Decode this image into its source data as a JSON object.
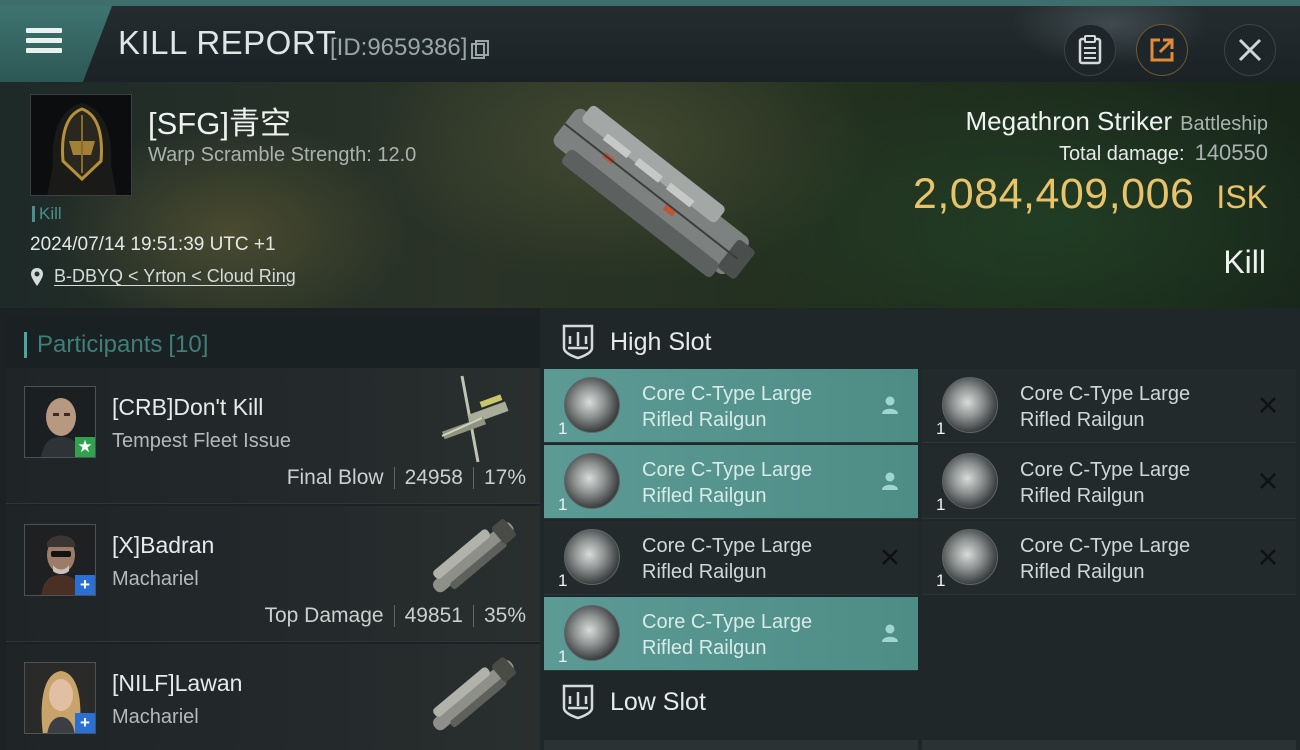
{
  "header": {
    "title": "KILL REPORT",
    "report_id": "[ID:9659386]"
  },
  "victim": {
    "name": "[SFG]青空",
    "warp_scramble": "Warp Scramble Strength: 12.0",
    "tag": "Kill",
    "timestamp": "2024/07/14 19:51:39 UTC +1",
    "location": "B-DBYQ < Yrton < Cloud Ring",
    "ship_name": "Megathron Striker",
    "ship_class": "Battleship",
    "total_damage_label": "Total damage:",
    "total_damage": "140550",
    "isk_value": "2,084,409,006",
    "isk_unit": "ISK",
    "kill_label": "Kill"
  },
  "participants": {
    "label": "Participants",
    "count": "[10]",
    "rows": [
      {
        "name": "[CRB]Don't Kill",
        "ship": "Tempest Fleet Issue",
        "stat_label": "Final Blow",
        "damage": "24958",
        "percent": "17%",
        "badge": "star"
      },
      {
        "name": "[X]Badran",
        "ship": "Machariel",
        "stat_label": "Top Damage",
        "damage": "49851",
        "percent": "35%",
        "badge": "plus"
      },
      {
        "name": "[NILF]Lawan",
        "ship": "Machariel",
        "badge": "plus"
      }
    ]
  },
  "fitting": {
    "high_slot_label": "High Slot",
    "low_slot_label": "Low Slot",
    "high_modules": [
      {
        "name_line1": "Core C-Type Large",
        "name_line2": "Rifled Railgun",
        "qty": "1",
        "state": "dropped"
      },
      {
        "name_line1": "Core C-Type Large",
        "name_line2": "Rifled Railgun",
        "qty": "1",
        "state": "destroyed"
      },
      {
        "name_line1": "Core C-Type Large",
        "name_line2": "Rifled Railgun",
        "qty": "1",
        "state": "dropped"
      },
      {
        "name_line1": "Core C-Type Large",
        "name_line2": "Rifled Railgun",
        "qty": "1",
        "state": "destroyed"
      },
      {
        "name_line1": "Core C-Type Large",
        "name_line2": "Rifled Railgun",
        "qty": "1",
        "state": "destroyed"
      },
      {
        "name_line1": "Core C-Type Large",
        "name_line2": "Rifled Railgun",
        "qty": "1",
        "state": "destroyed"
      },
      {
        "name_line1": "Core C-Type Large",
        "name_line2": "Rifled Railgun",
        "qty": "1",
        "state": "dropped"
      }
    ]
  },
  "colors": {
    "accent_teal": "#4e8c86",
    "isk_gold": "#e9c36a",
    "badge_green": "#2fa24c",
    "badge_blue": "#2a6fd6"
  }
}
